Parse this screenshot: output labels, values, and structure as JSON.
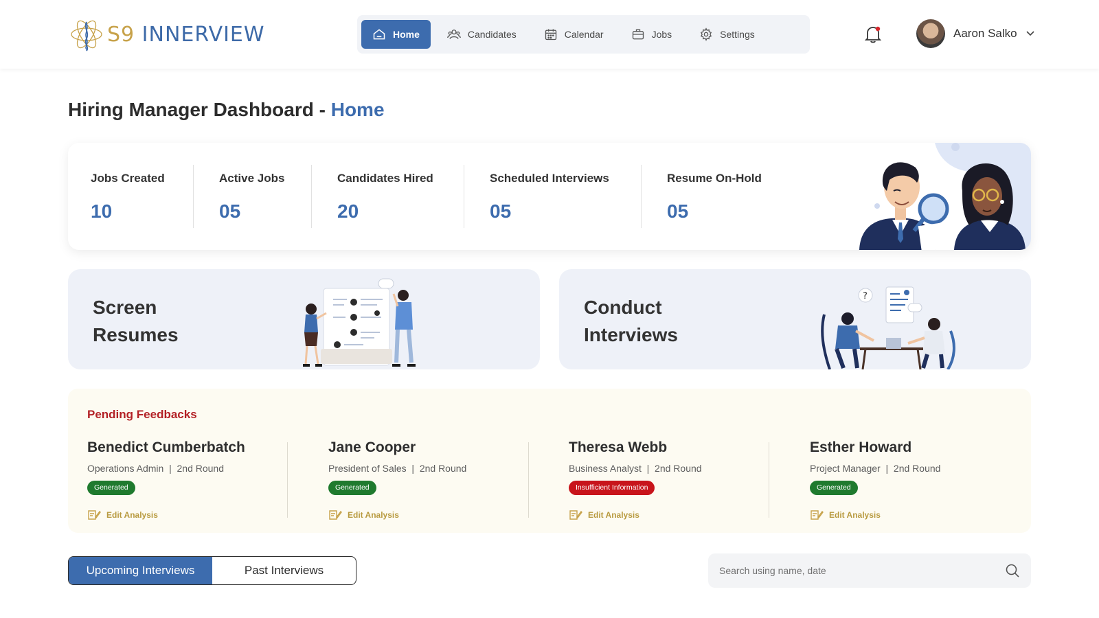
{
  "brand": {
    "prefix": "S9",
    "name": " INNERVIEW"
  },
  "nav": [
    {
      "label": "Home",
      "icon": "home-icon",
      "active": true
    },
    {
      "label": "Candidates",
      "icon": "users-icon"
    },
    {
      "label": "Calendar",
      "icon": "calendar-icon"
    },
    {
      "label": "Jobs",
      "icon": "briefcase-icon"
    },
    {
      "label": "Settings",
      "icon": "gear-icon"
    }
  ],
  "user": {
    "name": "Aaron Salko"
  },
  "title": {
    "main": "Hiring Manager Dashboard - ",
    "crumb": "Home"
  },
  "stats": [
    {
      "label": "Jobs Created",
      "value": "10"
    },
    {
      "label": "Active Jobs",
      "value": "05"
    },
    {
      "label": "Candidates Hired",
      "value": "20"
    },
    {
      "label": "Scheduled Interviews",
      "value": "05"
    },
    {
      "label": "Resume On-Hold",
      "value": "05"
    }
  ],
  "actions": [
    {
      "label": "Screen Resumes"
    },
    {
      "label": "Conduct Interviews"
    }
  ],
  "pending": {
    "title": "Pending Feedbacks",
    "edit_label": "Edit Analysis",
    "items": [
      {
        "name": "Benedict Cumberbatch",
        "role": "Operations Admin",
        "round": "2nd Round",
        "status": "Generated",
        "status_color": "#1f7a2e"
      },
      {
        "name": "Jane Cooper",
        "role": "President of Sales",
        "round": "2nd Round",
        "status": "Generated",
        "status_color": "#1f7a2e"
      },
      {
        "name": "Theresa Webb",
        "role": "Business Analyst",
        "round": "2nd Round",
        "status": "Insufficient Information",
        "status_color": "#c8141b"
      },
      {
        "name": "Esther Howard",
        "role": "Project Manager",
        "round": "2nd Round",
        "status": "Generated",
        "status_color": "#1f7a2e"
      }
    ]
  },
  "tabs": [
    {
      "label": "Upcoming Interviews",
      "active": true
    },
    {
      "label": "Past Interviews"
    }
  ],
  "search": {
    "placeholder": "Search using name, date"
  },
  "colors": {
    "accent": "#3d6cae",
    "gold": "#c7a24a",
    "alert": "#b32025"
  }
}
